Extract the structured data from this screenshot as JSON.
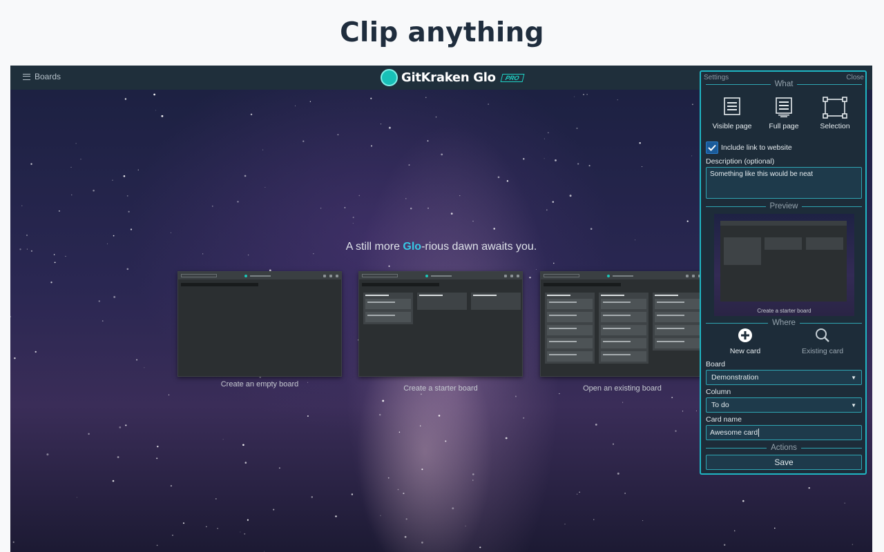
{
  "headline": "Clip anything",
  "topbar": {
    "boards_label": "Boards",
    "logo_text": "GitKraken Glo",
    "pro_badge": "PRO"
  },
  "tagline": {
    "before": "A still more ",
    "highlight": "Glo",
    "after": "-rious dawn awaits you."
  },
  "board_options": [
    {
      "caption": "Create an empty board"
    },
    {
      "caption": "Create a starter board"
    },
    {
      "caption": "Open an existing board"
    }
  ],
  "panel": {
    "settings_label": "Settings",
    "close_label": "Close",
    "what_title": "What",
    "what_options": [
      {
        "label": "Visible page",
        "icon": "visible-page-icon"
      },
      {
        "label": "Full page",
        "icon": "full-page-icon"
      },
      {
        "label": "Selection",
        "icon": "selection-icon"
      }
    ],
    "include_link_label": "Include link to website",
    "include_link_checked": true,
    "description_label": "Description (optional)",
    "description_value": "Something like this would be neat",
    "preview_title": "Preview",
    "preview_caption": "Create a starter board",
    "where_title": "Where",
    "where_options": [
      {
        "label": "New card",
        "icon": "plus-circle-icon",
        "selected": true
      },
      {
        "label": "Existing card",
        "icon": "search-icon",
        "selected": false
      }
    ],
    "board_label": "Board",
    "board_value": "Demonstration",
    "column_label": "Column",
    "column_value": "To do",
    "card_name_label": "Card name",
    "card_name_value": "Awesome card",
    "actions_title": "Actions",
    "save_label": "Save"
  },
  "colors": {
    "accent": "#1fb6c4",
    "highlight": "#37c9e6",
    "panel_bg": "#1d2c39"
  }
}
